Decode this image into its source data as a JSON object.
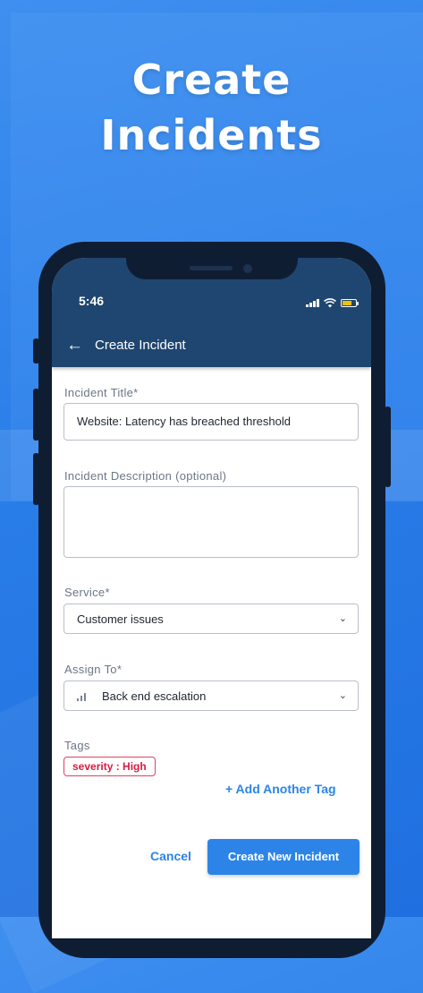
{
  "headline": {
    "line1": "Create",
    "line2": "Incidents"
  },
  "status_bar": {
    "time": "5:46"
  },
  "appbar": {
    "back_icon": "arrow-left-icon",
    "title": "Create Incident"
  },
  "form": {
    "title": {
      "label": "Incident Title*",
      "value": "Website: Latency has breached threshold"
    },
    "description": {
      "label": "Incident Description (optional)",
      "value": ""
    },
    "service": {
      "label": "Service*",
      "value": "Customer issues"
    },
    "assign_to": {
      "label": "Assign To*",
      "value": "Back end escalation",
      "icon": "escalation-bars-icon"
    },
    "tags": {
      "label": "Tags",
      "items": [
        "severity : High"
      ],
      "add_label": "+ Add Another Tag"
    }
  },
  "actions": {
    "cancel_label": "Cancel",
    "create_label": "Create New Incident"
  },
  "colors": {
    "accent": "#2c84e8",
    "appbar": "#1f4670",
    "tag": "#d81b44",
    "battery": "#f2c200"
  }
}
